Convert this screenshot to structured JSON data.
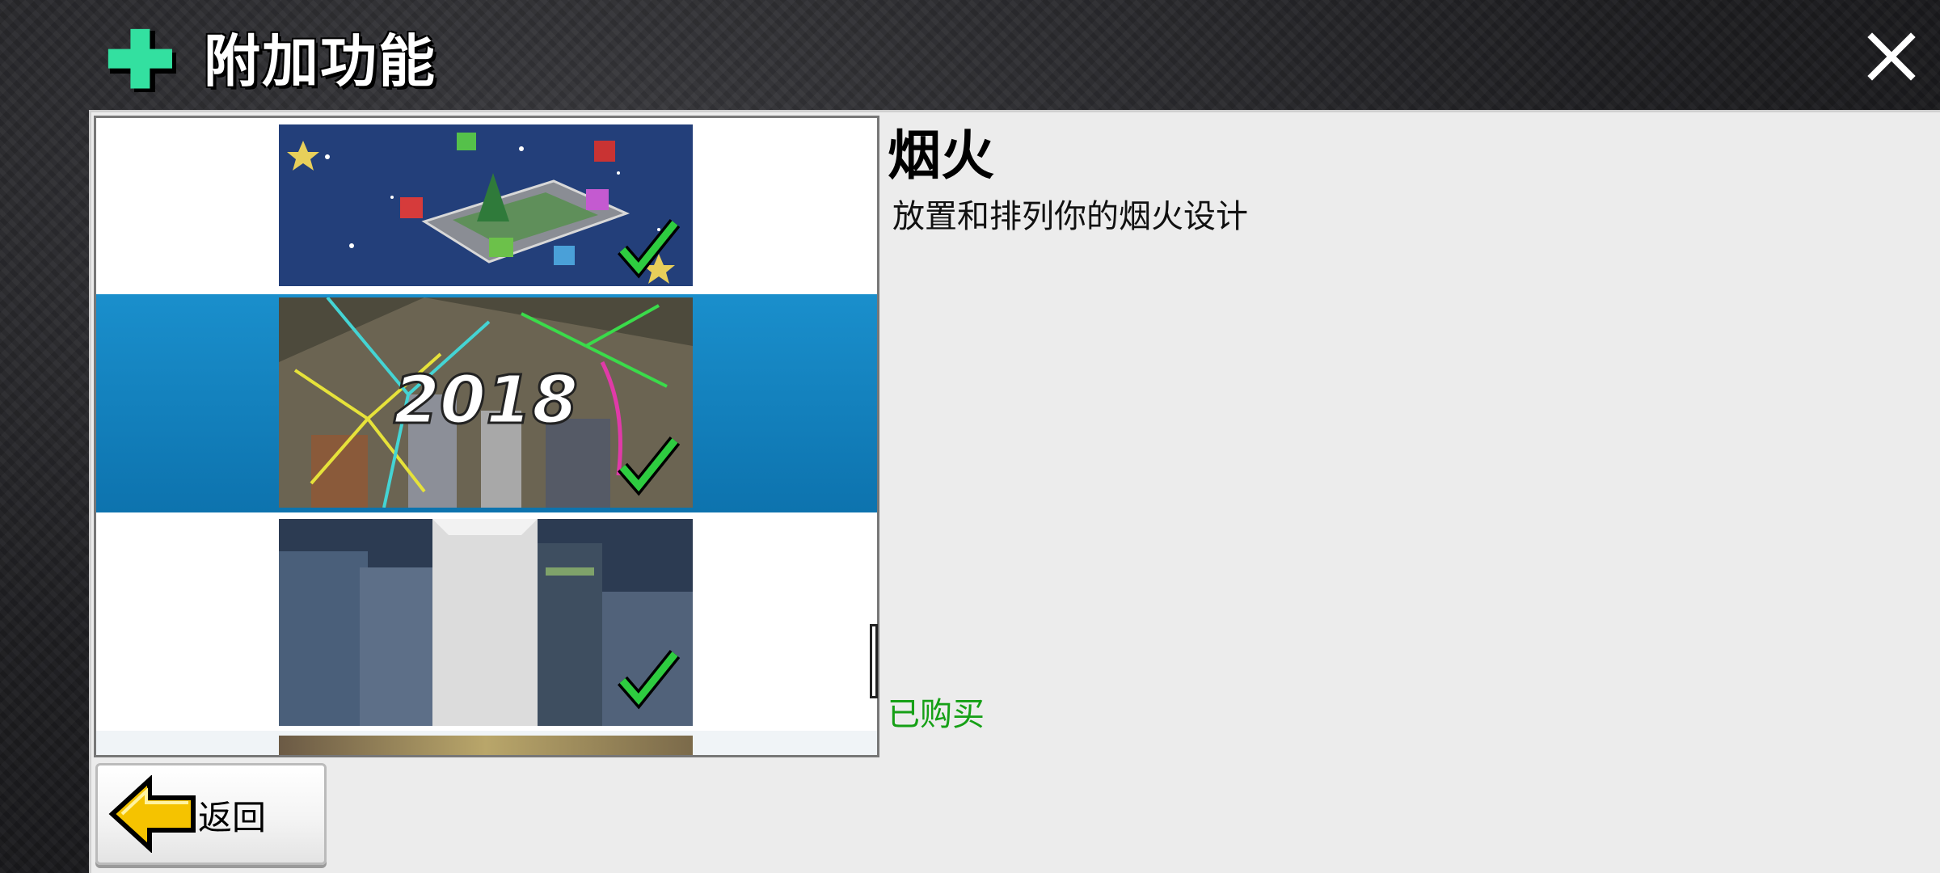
{
  "header": {
    "title": "附加功能",
    "icons": {
      "left": "plus-icon",
      "right": "close-icon"
    }
  },
  "addon_list": {
    "items": [
      {
        "name": "holiday",
        "badge": "checkmark-icon",
        "selected": false
      },
      {
        "name": "fireworks",
        "banner_text": "2018",
        "badge": "checkmark-icon",
        "selected": true
      },
      {
        "name": "skyscrapers",
        "badge": "checkmark-icon",
        "selected": false
      },
      {
        "name": "partial-next",
        "selected": false
      }
    ]
  },
  "detail": {
    "title": "烟火",
    "description": "放置和排列你的烟火设计",
    "status": "已购买"
  },
  "footer": {
    "back_label": "返回",
    "back_icon": "back-arrow-icon"
  },
  "colors": {
    "selection": "#1a8fcc",
    "status_green": "#16a016",
    "check_green": "#2ecc40",
    "plus_green": "#33e0a0",
    "arrow_yellow": "#f5c300"
  }
}
